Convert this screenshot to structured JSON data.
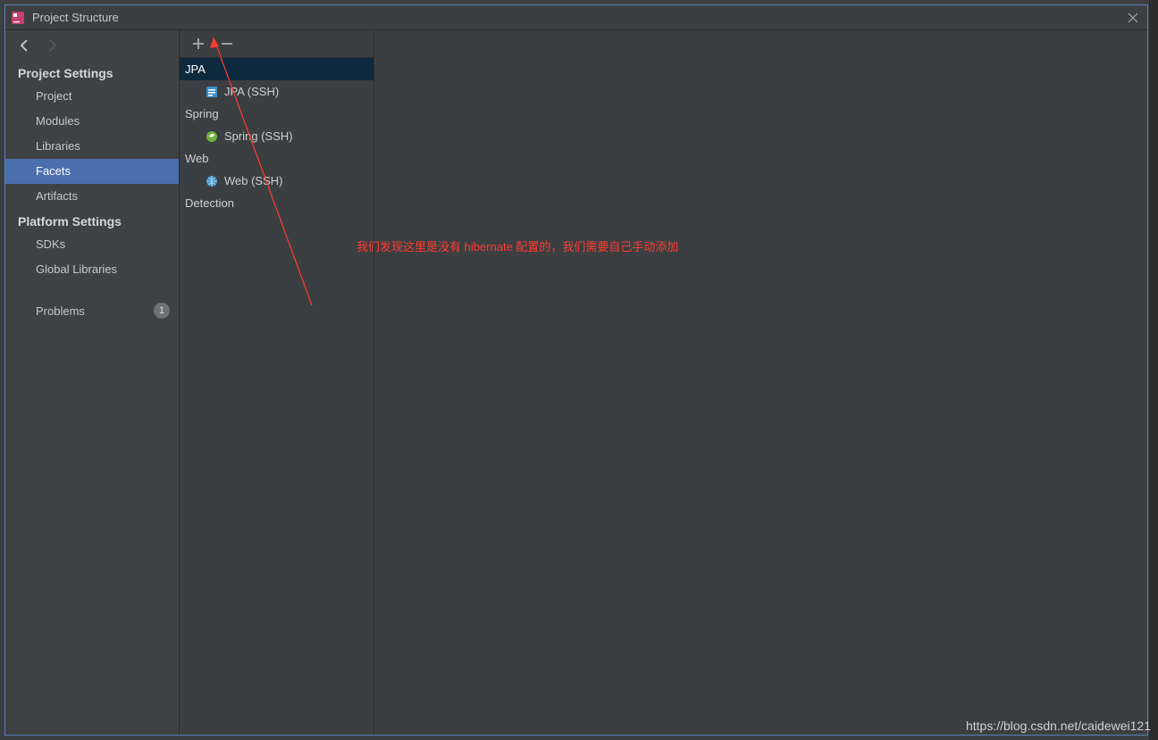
{
  "window": {
    "title": "Project Structure"
  },
  "sidebar": {
    "sections": [
      {
        "header": "Project Settings",
        "items": [
          "Project",
          "Modules",
          "Libraries",
          "Facets",
          "Artifacts"
        ],
        "selected_index": 3
      },
      {
        "header": "Platform Settings",
        "items": [
          "SDKs",
          "Global Libraries"
        ]
      }
    ],
    "problems": {
      "label": "Problems",
      "count": "1"
    }
  },
  "facets_tree": {
    "groups": [
      {
        "name": "JPA",
        "children": [
          {
            "label": "JPA (SSH)",
            "icon": "jpa"
          }
        ]
      },
      {
        "name": "Spring",
        "children": [
          {
            "label": "Spring (SSH)",
            "icon": "spring"
          }
        ]
      },
      {
        "name": "Web",
        "children": [
          {
            "label": "Web (SSH)",
            "icon": "web"
          }
        ]
      }
    ],
    "detection_label": "Detection",
    "selected_group_index": 0
  },
  "annotation": {
    "text": "我们发现这里是没有 hibernate 配置的，我们需要自己手动添加"
  },
  "watermark": "https://blog.csdn.net/caidewei121"
}
